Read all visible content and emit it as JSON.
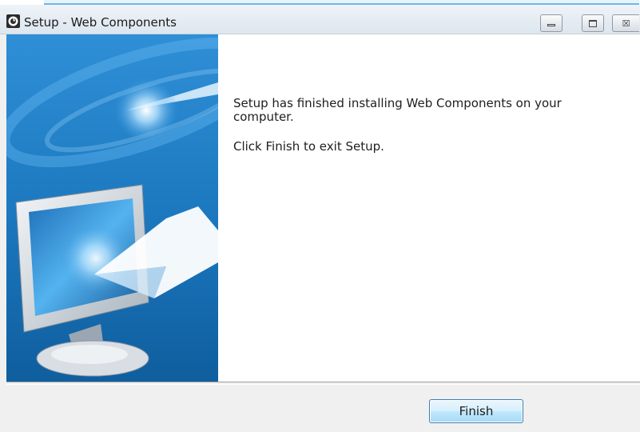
{
  "window": {
    "title": "Setup - Web Components",
    "controls": [
      "minimize-icon",
      "maximize-icon",
      "close-icon"
    ],
    "close_glyph": "☒"
  },
  "content": {
    "message_line1": "Setup has finished installing Web Components on your computer.",
    "message_line2": "Click Finish to exit Setup."
  },
  "footer": {
    "finish_label": "Finish"
  },
  "colors": {
    "accent": "#3c7fb1",
    "banner_blue": "#1a78c2",
    "button_fill": "#bee6fd"
  }
}
